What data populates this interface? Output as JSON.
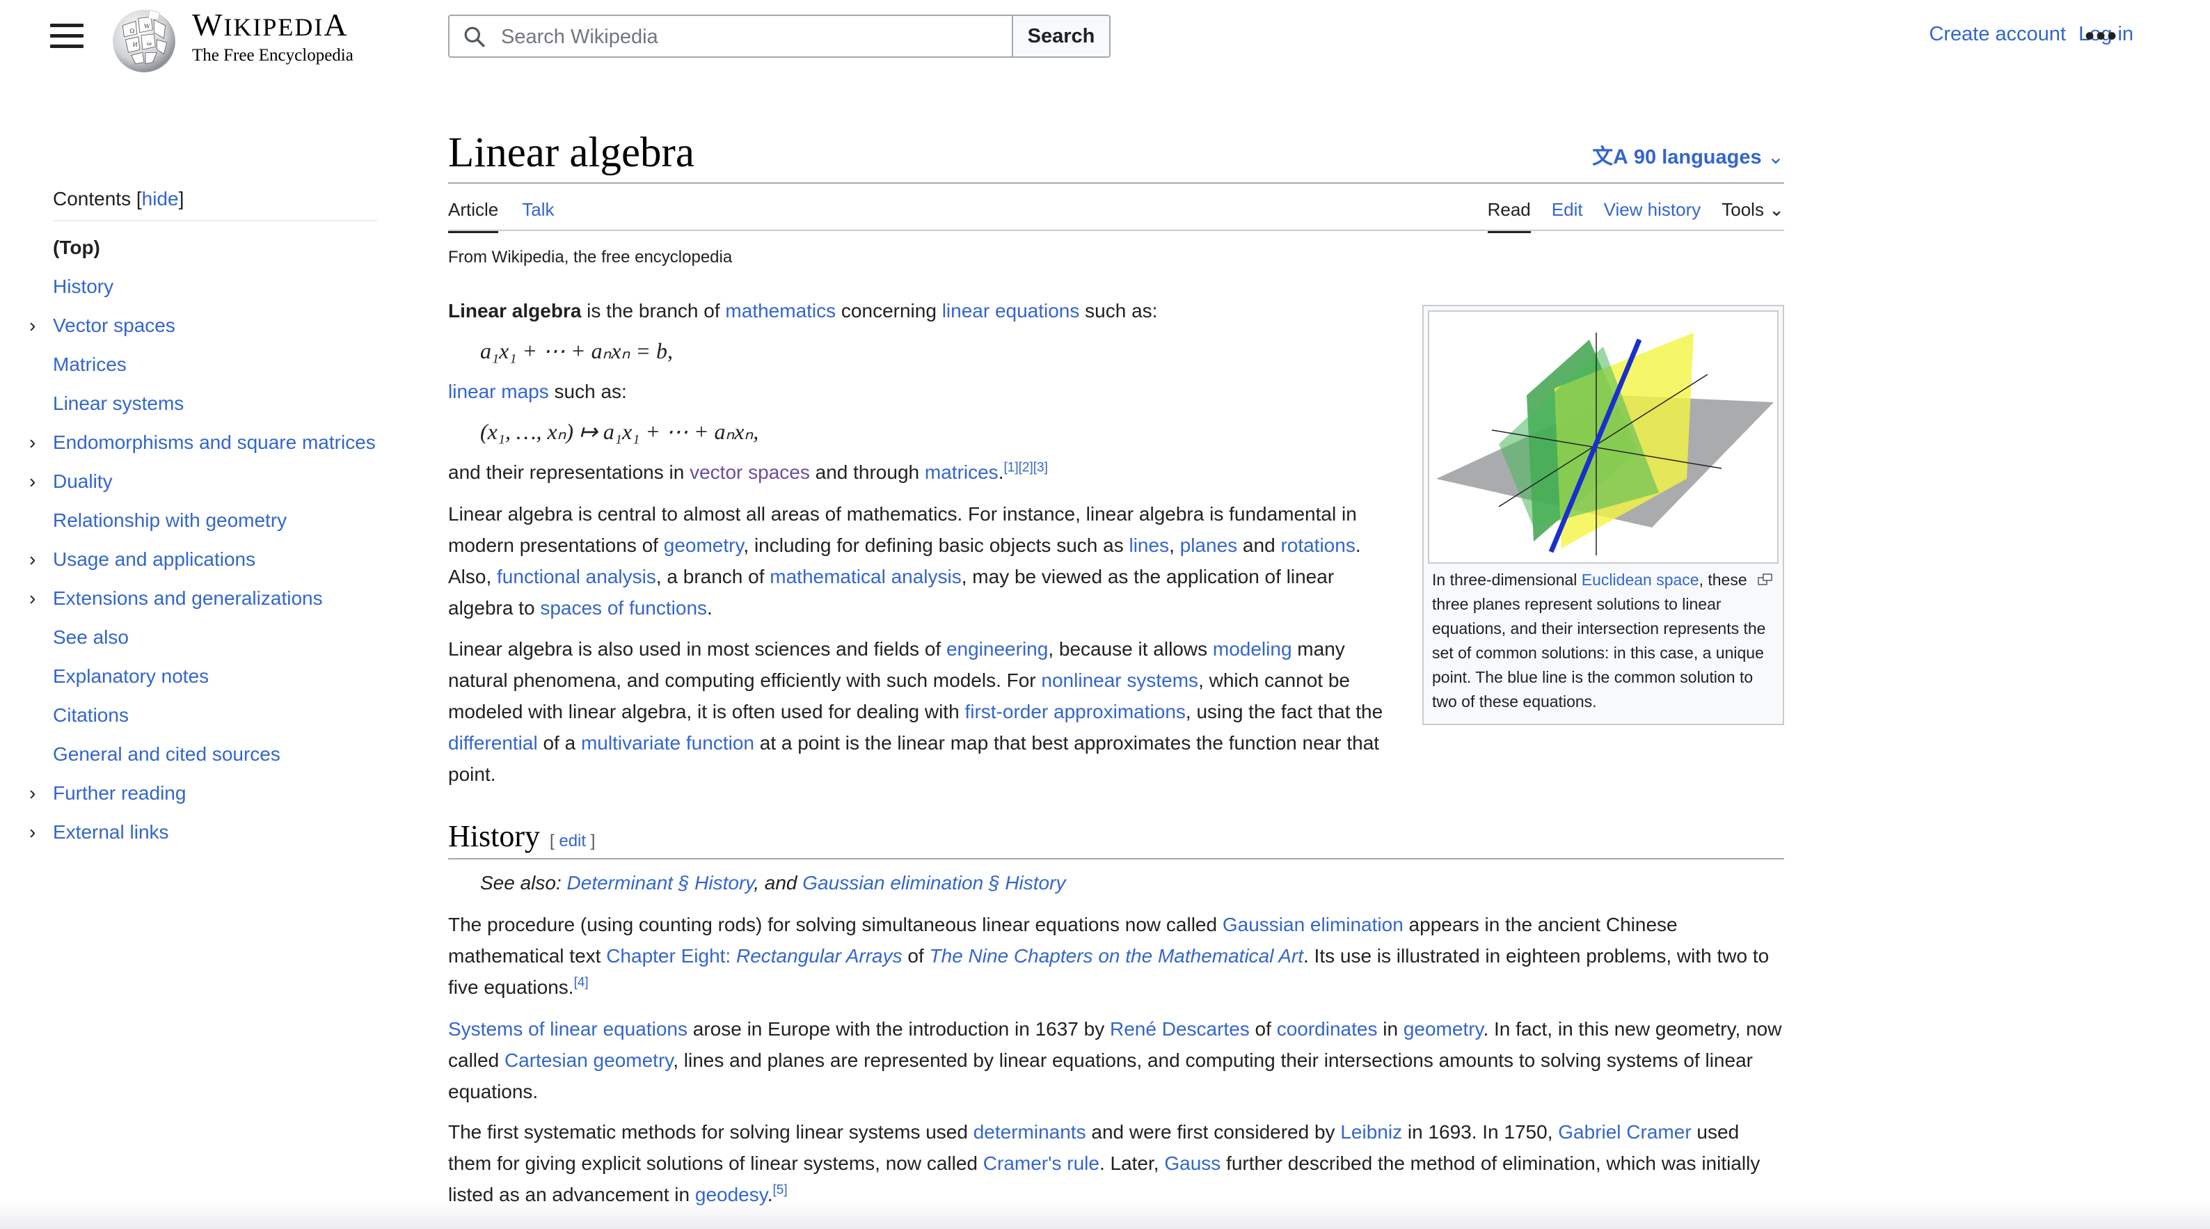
{
  "header": {
    "wordmark": "Wikipedia",
    "tagline": "The Free Encyclopedia",
    "search_placeholder": "Search Wikipedia",
    "search_button": "Search",
    "create_account": "Create account",
    "log_in": "Log in",
    "more": "•••"
  },
  "toc": {
    "title": "Contents",
    "hide": "hide",
    "items": [
      {
        "label": "(Top)",
        "expandable": false
      },
      {
        "label": "History",
        "expandable": false
      },
      {
        "label": "Vector spaces",
        "expandable": true
      },
      {
        "label": "Matrices",
        "expandable": false
      },
      {
        "label": "Linear systems",
        "expandable": false
      },
      {
        "label": "Endomorphisms and square matrices",
        "expandable": true
      },
      {
        "label": "Duality",
        "expandable": true
      },
      {
        "label": "Relationship with geometry",
        "expandable": false
      },
      {
        "label": "Usage and applications",
        "expandable": true
      },
      {
        "label": "Extensions and generalizations",
        "expandable": true
      },
      {
        "label": "See also",
        "expandable": false
      },
      {
        "label": "Explanatory notes",
        "expandable": false
      },
      {
        "label": "Citations",
        "expandable": false
      },
      {
        "label": "General and cited sources",
        "expandable": false
      },
      {
        "label": "Further reading",
        "expandable": true
      },
      {
        "label": "External links",
        "expandable": true
      }
    ]
  },
  "article": {
    "title": "Linear algebra",
    "languages": "90 languages",
    "tabs_left": [
      "Article",
      "Talk"
    ],
    "tabs_right": [
      "Read",
      "Edit",
      "View history",
      "Tools"
    ],
    "tagline": "From Wikipedia, the free encyclopedia",
    "intro": {
      "bold": "Linear algebra",
      "t1": " is the branch of ",
      "l1": "mathematics",
      "t2": " concerning ",
      "l2": "linear equations",
      "t3": " such as:"
    },
    "eq1": "a₁x₁ + ⋯ + aₙxₙ = b,",
    "maps": {
      "l1": "linear maps",
      "t1": " such as:"
    },
    "eq2": "(x₁, …, xₙ) ↦ a₁x₁ + ⋯ + aₙxₙ,",
    "reps": {
      "t1": "and their representations in ",
      "l1": "vector spaces",
      "t2": " and through ",
      "l2": "matrices",
      "t3": ".",
      "refs": "[1][2][3]"
    },
    "p2": {
      "t1": "Linear algebra is central to almost all areas of mathematics. For instance, linear algebra is fundamental in modern presentations of ",
      "l1": "geometry",
      "t2": ", including for defining basic objects such as ",
      "l2": "lines",
      "t3": ", ",
      "l3": "planes",
      "t4": " and ",
      "l4": "rotations",
      "t5": ". Also, ",
      "l5": "functional analysis",
      "t6": ", a branch of ",
      "l6": "mathematical analysis",
      "t7": ", may be viewed as the application of linear algebra to ",
      "l7": "spaces of functions",
      "t8": "."
    },
    "p3": {
      "t1": "Linear algebra is also used in most sciences and fields of ",
      "l1": "engineering",
      "t2": ", because it allows ",
      "l2": "modeling",
      "t3": " many natural phenomena, and computing efficiently with such models. For ",
      "l3": "nonlinear systems",
      "t4": ", which cannot be modeled with linear algebra, it is often used for dealing with ",
      "l4": "first-order approximations",
      "t5": ", using the fact that the ",
      "l5": "differential",
      "t6": " of a ",
      "l6": "multivariate function",
      "t7": " at a point is the linear map that best approximates the function near that point."
    },
    "figure": {
      "cap_t1": "In three-dimensional ",
      "cap_l1": "Euclidean space",
      "cap_t2": ", these three planes represent solutions to linear equations, and their intersection represents the set of common solutions: in this case, a unique point. The blue line is the common solution to two of these equations."
    },
    "history": {
      "heading": "History",
      "edit": "edit",
      "see_also_label": "See also: ",
      "see_also_l1": "Determinant § History",
      "see_also_t": ", and ",
      "see_also_l2": "Gaussian elimination § History",
      "h1": {
        "t1": "The procedure (using counting rods) for solving simultaneous linear equations now called ",
        "l1": "Gaussian elimination",
        "t2": " appears in the ancient Chinese mathematical text ",
        "l2": "Chapter Eight: ",
        "l2i": "Rectangular Arrays",
        "t3": " of ",
        "l3": "The Nine Chapters on the Mathematical Art",
        "t4": ". Its use is illustrated in eighteen problems, with two to five equations.",
        "ref": "[4]"
      },
      "h2": {
        "l1": "Systems of linear equations",
        "t1": " arose in Europe with the introduction in 1637 by ",
        "l2": "René Descartes",
        "t2": " of ",
        "l3": "coordinates",
        "t3": " in ",
        "l4": "geometry",
        "t4": ". In fact, in this new geometry, now called ",
        "l5": "Cartesian geometry",
        "t5": ", lines and planes are represented by linear equations, and computing their intersections amounts to solving systems of linear equations."
      },
      "h3": {
        "t1": "The first systematic methods for solving linear systems used ",
        "l1": "determinants",
        "t2": " and were first considered by ",
        "l2": "Leibniz",
        "t3": " in 1693. In 1750, ",
        "l3": "Gabriel Cramer",
        "t4": " used them for giving explicit solutions of linear systems, now called ",
        "l4": "Cramer's rule",
        "t5": ". Later, ",
        "l5": "Gauss",
        "t6": " further described the method of elimination, which was initially listed as an advancement in ",
        "l6": "geodesy",
        "t7": ".",
        "ref": "[5]"
      }
    }
  },
  "colors": {
    "link": "#3366cc",
    "visited": "#6b4ba1",
    "text": "#202122"
  }
}
